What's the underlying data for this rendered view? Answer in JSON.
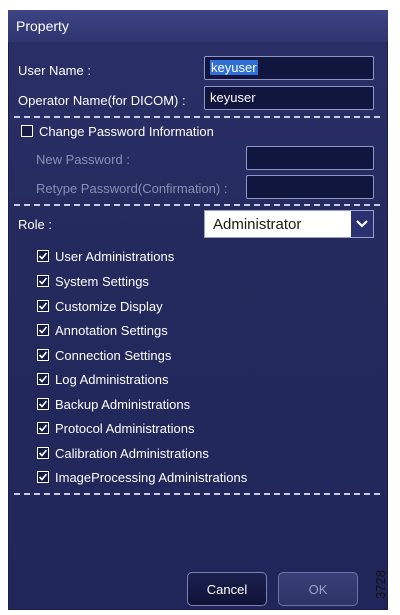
{
  "dialog": {
    "title": "Property"
  },
  "user_name": {
    "label": "User Name :",
    "value": "keyuser"
  },
  "operator_name": {
    "label": "Operator Name(for DICOM) :",
    "value": "keyuser"
  },
  "change_password": {
    "label": "Change Password Information",
    "checked": false
  },
  "new_password": {
    "label": "New Password :",
    "value": ""
  },
  "retype_password": {
    "label": "Retype Password(Confirmation) :",
    "value": ""
  },
  "role": {
    "label": "Role :",
    "selected": "Administrator"
  },
  "permissions": [
    {
      "label": "User Administrations",
      "checked": true
    },
    {
      "label": "System Settings",
      "checked": true
    },
    {
      "label": "Customize Display",
      "checked": true
    },
    {
      "label": "Annotation Settings",
      "checked": true
    },
    {
      "label": "Connection Settings",
      "checked": true
    },
    {
      "label": "Log Administrations",
      "checked": true
    },
    {
      "label": "Backup Administrations",
      "checked": true
    },
    {
      "label": "Protocol Administrations",
      "checked": true
    },
    {
      "label": "Calibration Administrations",
      "checked": true
    },
    {
      "label": "ImageProcessing Administrations",
      "checked": true
    }
  ],
  "buttons": {
    "cancel": "Cancel",
    "ok": "OK"
  },
  "figure_number": "3728",
  "colors": {
    "panel": "#242a5d",
    "titlebar": "#3d4384",
    "field_bg": "#11163f",
    "selection": "#2f6fd6"
  }
}
